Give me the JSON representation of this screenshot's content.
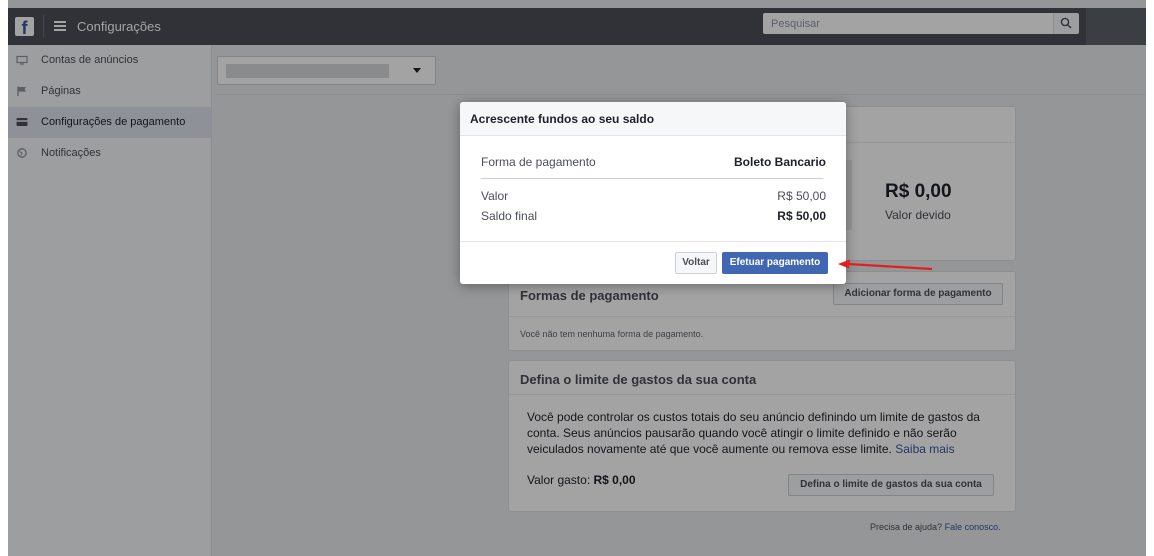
{
  "app": {
    "title": "Configurações"
  },
  "search": {
    "placeholder": "Pesquisar"
  },
  "sidebar": {
    "items": [
      {
        "label": "Contas de anúncios",
        "icon": "ad-account-icon"
      },
      {
        "label": "Páginas",
        "icon": "flag-icon"
      },
      {
        "label": "Configurações de pagamento",
        "icon": "card-icon",
        "active": true
      },
      {
        "label": "Notificações",
        "icon": "globe-icon"
      }
    ]
  },
  "balance": {
    "value": "R$ 0,00",
    "label": "Valor devido"
  },
  "payment_methods": {
    "title": "Formas de pagamento",
    "add_button": "Adicionar forma de pagamento",
    "empty_text": "Você não tem nenhuma forma de pagamento."
  },
  "spending_limit": {
    "title": "Defina o limite de gastos da sua conta",
    "description": "Você pode controlar os custos totais do seu anúncio definindo um limite de gastos da conta. Seus anúncios pausarão quando você atingir o limite definido e não serão veiculados novamente até que você aumente ou remova esse limite.",
    "learn_more": "Saiba mais",
    "spent_label": "Valor gasto:",
    "spent_value": "R$ 0,00",
    "button": "Defina o limite de gastos da sua conta"
  },
  "help": {
    "text": "Precisa de ajuda?",
    "link": "Fale conosco."
  },
  "modal": {
    "title": "Acrescente fundos ao seu saldo",
    "payment_method_label": "Forma de pagamento",
    "payment_method_value": "Boleto Bancario",
    "amount_label": "Valor",
    "amount_value": "R$ 50,00",
    "final_balance_label": "Saldo final",
    "final_balance_value": "R$ 50,00",
    "back_button": "Voltar",
    "pay_button": "Efetuar pagamento"
  },
  "colors": {
    "topbar": "#4b4f56",
    "primary": "#4267b2",
    "annotation_arrow": "#e02020"
  }
}
